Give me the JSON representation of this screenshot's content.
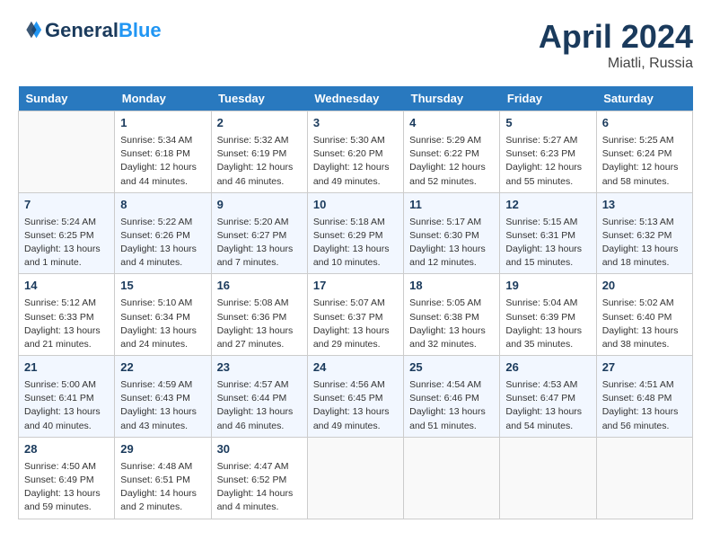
{
  "header": {
    "logo_line1": "General",
    "logo_line2": "Blue",
    "month": "April 2024",
    "location": "Miatli, Russia"
  },
  "weekdays": [
    "Sunday",
    "Monday",
    "Tuesday",
    "Wednesday",
    "Thursday",
    "Friday",
    "Saturday"
  ],
  "weeks": [
    [
      {
        "day": "",
        "info": ""
      },
      {
        "day": "1",
        "info": "Sunrise: 5:34 AM\nSunset: 6:18 PM\nDaylight: 12 hours\nand 44 minutes."
      },
      {
        "day": "2",
        "info": "Sunrise: 5:32 AM\nSunset: 6:19 PM\nDaylight: 12 hours\nand 46 minutes."
      },
      {
        "day": "3",
        "info": "Sunrise: 5:30 AM\nSunset: 6:20 PM\nDaylight: 12 hours\nand 49 minutes."
      },
      {
        "day": "4",
        "info": "Sunrise: 5:29 AM\nSunset: 6:22 PM\nDaylight: 12 hours\nand 52 minutes."
      },
      {
        "day": "5",
        "info": "Sunrise: 5:27 AM\nSunset: 6:23 PM\nDaylight: 12 hours\nand 55 minutes."
      },
      {
        "day": "6",
        "info": "Sunrise: 5:25 AM\nSunset: 6:24 PM\nDaylight: 12 hours\nand 58 minutes."
      }
    ],
    [
      {
        "day": "7",
        "info": "Sunrise: 5:24 AM\nSunset: 6:25 PM\nDaylight: 13 hours\nand 1 minute."
      },
      {
        "day": "8",
        "info": "Sunrise: 5:22 AM\nSunset: 6:26 PM\nDaylight: 13 hours\nand 4 minutes."
      },
      {
        "day": "9",
        "info": "Sunrise: 5:20 AM\nSunset: 6:27 PM\nDaylight: 13 hours\nand 7 minutes."
      },
      {
        "day": "10",
        "info": "Sunrise: 5:18 AM\nSunset: 6:29 PM\nDaylight: 13 hours\nand 10 minutes."
      },
      {
        "day": "11",
        "info": "Sunrise: 5:17 AM\nSunset: 6:30 PM\nDaylight: 13 hours\nand 12 minutes."
      },
      {
        "day": "12",
        "info": "Sunrise: 5:15 AM\nSunset: 6:31 PM\nDaylight: 13 hours\nand 15 minutes."
      },
      {
        "day": "13",
        "info": "Sunrise: 5:13 AM\nSunset: 6:32 PM\nDaylight: 13 hours\nand 18 minutes."
      }
    ],
    [
      {
        "day": "14",
        "info": "Sunrise: 5:12 AM\nSunset: 6:33 PM\nDaylight: 13 hours\nand 21 minutes."
      },
      {
        "day": "15",
        "info": "Sunrise: 5:10 AM\nSunset: 6:34 PM\nDaylight: 13 hours\nand 24 minutes."
      },
      {
        "day": "16",
        "info": "Sunrise: 5:08 AM\nSunset: 6:36 PM\nDaylight: 13 hours\nand 27 minutes."
      },
      {
        "day": "17",
        "info": "Sunrise: 5:07 AM\nSunset: 6:37 PM\nDaylight: 13 hours\nand 29 minutes."
      },
      {
        "day": "18",
        "info": "Sunrise: 5:05 AM\nSunset: 6:38 PM\nDaylight: 13 hours\nand 32 minutes."
      },
      {
        "day": "19",
        "info": "Sunrise: 5:04 AM\nSunset: 6:39 PM\nDaylight: 13 hours\nand 35 minutes."
      },
      {
        "day": "20",
        "info": "Sunrise: 5:02 AM\nSunset: 6:40 PM\nDaylight: 13 hours\nand 38 minutes."
      }
    ],
    [
      {
        "day": "21",
        "info": "Sunrise: 5:00 AM\nSunset: 6:41 PM\nDaylight: 13 hours\nand 40 minutes."
      },
      {
        "day": "22",
        "info": "Sunrise: 4:59 AM\nSunset: 6:43 PM\nDaylight: 13 hours\nand 43 minutes."
      },
      {
        "day": "23",
        "info": "Sunrise: 4:57 AM\nSunset: 6:44 PM\nDaylight: 13 hours\nand 46 minutes."
      },
      {
        "day": "24",
        "info": "Sunrise: 4:56 AM\nSunset: 6:45 PM\nDaylight: 13 hours\nand 49 minutes."
      },
      {
        "day": "25",
        "info": "Sunrise: 4:54 AM\nSunset: 6:46 PM\nDaylight: 13 hours\nand 51 minutes."
      },
      {
        "day": "26",
        "info": "Sunrise: 4:53 AM\nSunset: 6:47 PM\nDaylight: 13 hours\nand 54 minutes."
      },
      {
        "day": "27",
        "info": "Sunrise: 4:51 AM\nSunset: 6:48 PM\nDaylight: 13 hours\nand 56 minutes."
      }
    ],
    [
      {
        "day": "28",
        "info": "Sunrise: 4:50 AM\nSunset: 6:49 PM\nDaylight: 13 hours\nand 59 minutes."
      },
      {
        "day": "29",
        "info": "Sunrise: 4:48 AM\nSunset: 6:51 PM\nDaylight: 14 hours\nand 2 minutes."
      },
      {
        "day": "30",
        "info": "Sunrise: 4:47 AM\nSunset: 6:52 PM\nDaylight: 14 hours\nand 4 minutes."
      },
      {
        "day": "",
        "info": ""
      },
      {
        "day": "",
        "info": ""
      },
      {
        "day": "",
        "info": ""
      },
      {
        "day": "",
        "info": ""
      }
    ]
  ]
}
